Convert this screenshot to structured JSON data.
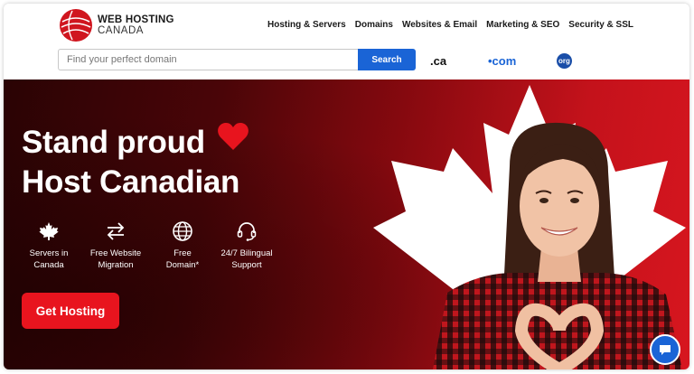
{
  "brand": {
    "line1": "WEB HOSTING",
    "line2": "CANADA",
    "color": "#d0161f"
  },
  "nav": {
    "items": [
      "Hosting & Servers",
      "Domains",
      "Websites & Email",
      "Marketing & SEO",
      "Security & SSL"
    ]
  },
  "search": {
    "placeholder": "Find your perfect domain",
    "value": "",
    "button_label": "Search"
  },
  "tlds": {
    "ca": ".ca",
    "com": "•com",
    "org": "org"
  },
  "hero": {
    "headline_line1": "Stand proud",
    "headline_line2": "Host Canadian",
    "features": [
      {
        "icon": "maple-leaf-icon",
        "line1": "Servers in",
        "line2": "Canada"
      },
      {
        "icon": "transfer-arrows-icon",
        "line1": "Free Website",
        "line2": "Migration"
      },
      {
        "icon": "globe-icon",
        "line1": "Free",
        "line2": "Domain*"
      },
      {
        "icon": "headset-icon",
        "line1": "24/7 Bilingual",
        "line2": "Support"
      }
    ],
    "cta_label": "Get Hosting"
  },
  "colors": {
    "accent_blue": "#1a64d6",
    "accent_red": "#e8141e",
    "heart": "#e8141e"
  },
  "chat": {
    "icon": "chat-bubble-icon"
  }
}
